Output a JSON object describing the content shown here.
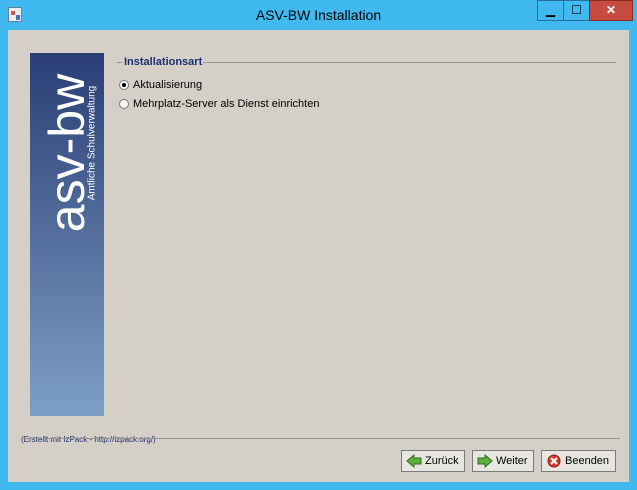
{
  "window": {
    "title": "ASV-BW Installation",
    "controls": {
      "minimize": "▁",
      "maximize": "☐",
      "close": "✕"
    }
  },
  "sidebar": {
    "logo_text": "asv-bw",
    "subtitle": "Amtliche Schulverwaltung"
  },
  "section": {
    "legend": "Installationsart",
    "options": [
      {
        "label": "Aktualisierung",
        "selected": true
      },
      {
        "label": "Mehrplatz-Server als Dienst einrichten",
        "selected": false
      }
    ]
  },
  "footer": {
    "credit": "(Erstellt mit IzPack - http://izpack.org/)",
    "buttons": {
      "back": "Zurück",
      "next": "Weiter",
      "quit": "Beenden"
    }
  },
  "colors": {
    "titlebar": "#3fb9ef",
    "panel": "#d4d0c8",
    "accent_text": "#1c2e72"
  }
}
